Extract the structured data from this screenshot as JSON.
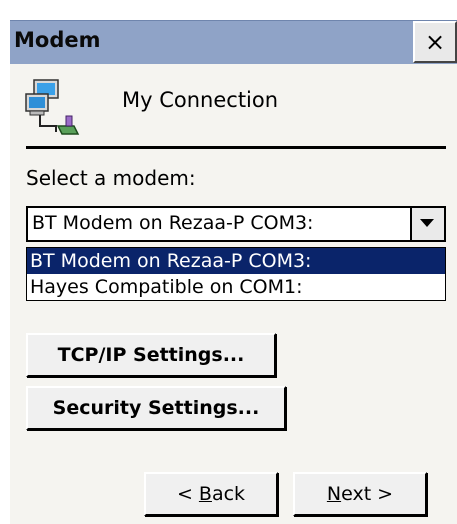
{
  "window": {
    "title": "Modem",
    "close_label": "×"
  },
  "connection": {
    "name": "My Connection",
    "icon": "network-connection-icon"
  },
  "modem_select": {
    "label": "Select a modem:",
    "value": "BT Modem on Rezaa-P COM3:",
    "options": [
      "BT Modem on Rezaa-P COM3:",
      "Hayes Compatible on COM1:"
    ]
  },
  "buttons": {
    "tcpip": "TCP/IP Settings...",
    "security": "Security Settings...",
    "back_prefix": "< ",
    "back_mnemonic": "B",
    "back_rest": "ack",
    "next_mnemonic": "N",
    "next_rest": "ext >"
  },
  "colors": {
    "titlebar": "#8fa3c7",
    "selection": "#0a246a"
  }
}
